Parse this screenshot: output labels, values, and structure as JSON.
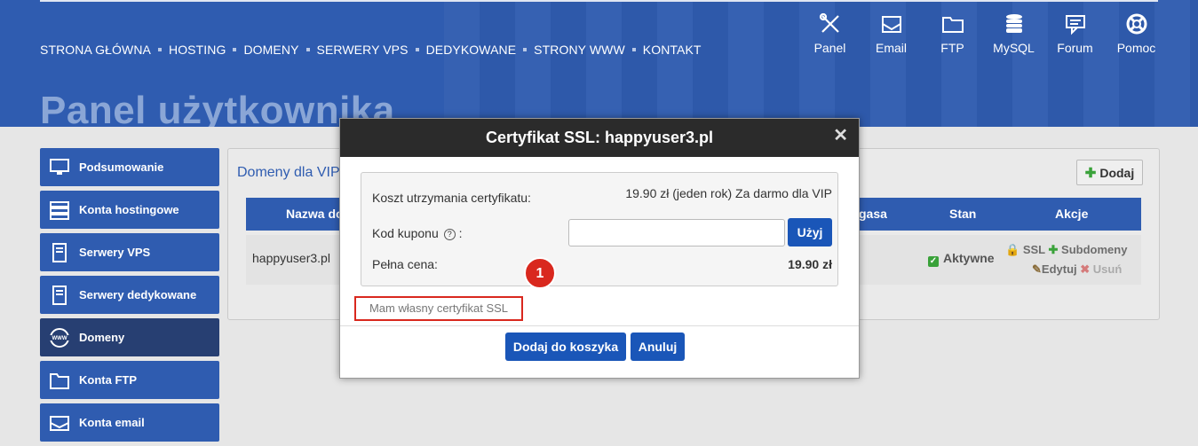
{
  "nav": {
    "items": [
      "STRONA GŁÓWNA",
      "HOSTING",
      "DOMENY",
      "SERWERY VPS",
      "DEDYKOWANE",
      "STRONY WWW",
      "KONTAKT"
    ]
  },
  "top_icons": [
    {
      "label": "Panel",
      "icon": "tools-icon"
    },
    {
      "label": "Email",
      "icon": "email-icon"
    },
    {
      "label": "FTP",
      "icon": "folder-icon"
    },
    {
      "label": "MySQL",
      "icon": "database-icon"
    },
    {
      "label": "Forum",
      "icon": "forum-icon"
    },
    {
      "label": "Pomoc",
      "icon": "lifebuoy-icon"
    }
  ],
  "page_title": "Panel użytkownika",
  "sidebar": {
    "items": [
      {
        "label": "Podsumowanie",
        "icon": "monitor-icon"
      },
      {
        "label": "Konta hostingowe",
        "icon": "server-icon"
      },
      {
        "label": "Serwery VPS",
        "icon": "tower-icon"
      },
      {
        "label": "Serwery dedykowane",
        "icon": "tower-icon"
      },
      {
        "label": "Domeny",
        "icon": "globe-www-icon"
      },
      {
        "label": "Konta FTP",
        "icon": "folder-icon"
      },
      {
        "label": "Konta email",
        "icon": "email-icon"
      }
    ]
  },
  "main": {
    "title": "Domeny dla VIP",
    "add_label": "Dodaj",
    "columns": {
      "name": "Nazwa do",
      "expires": "gasa",
      "status": "Stan",
      "actions": "Akcje"
    },
    "row": {
      "domain": "happyuser3.pl",
      "status": "Aktywne",
      "actions": [
        "SSL",
        "Subdomeny",
        "Edytuj",
        "Usuń"
      ]
    }
  },
  "modal": {
    "title": "Certyfikat SSL: happyuser3.pl",
    "close": "✕",
    "cost_label": "Koszt utrzymania certyfikatu:",
    "cost_value": "19.90 zł (jeden rok) Za darmo dla VIP",
    "coupon_label": "Kod kuponu",
    "coupon_suffix": ":",
    "coupon_value": "",
    "use_label": "Użyj",
    "full_price_label": "Pełna cena:",
    "full_price_value": "19.90 zł",
    "own_cert_label": "Mam własny certyfikat SSL",
    "badge": "1",
    "add_to_cart": "Dodaj do koszyka",
    "cancel": "Anuluj"
  },
  "colors": {
    "brand_blue": "#2f5cb0",
    "button_blue": "#1a56b8",
    "highlight_red": "#d9281e"
  }
}
